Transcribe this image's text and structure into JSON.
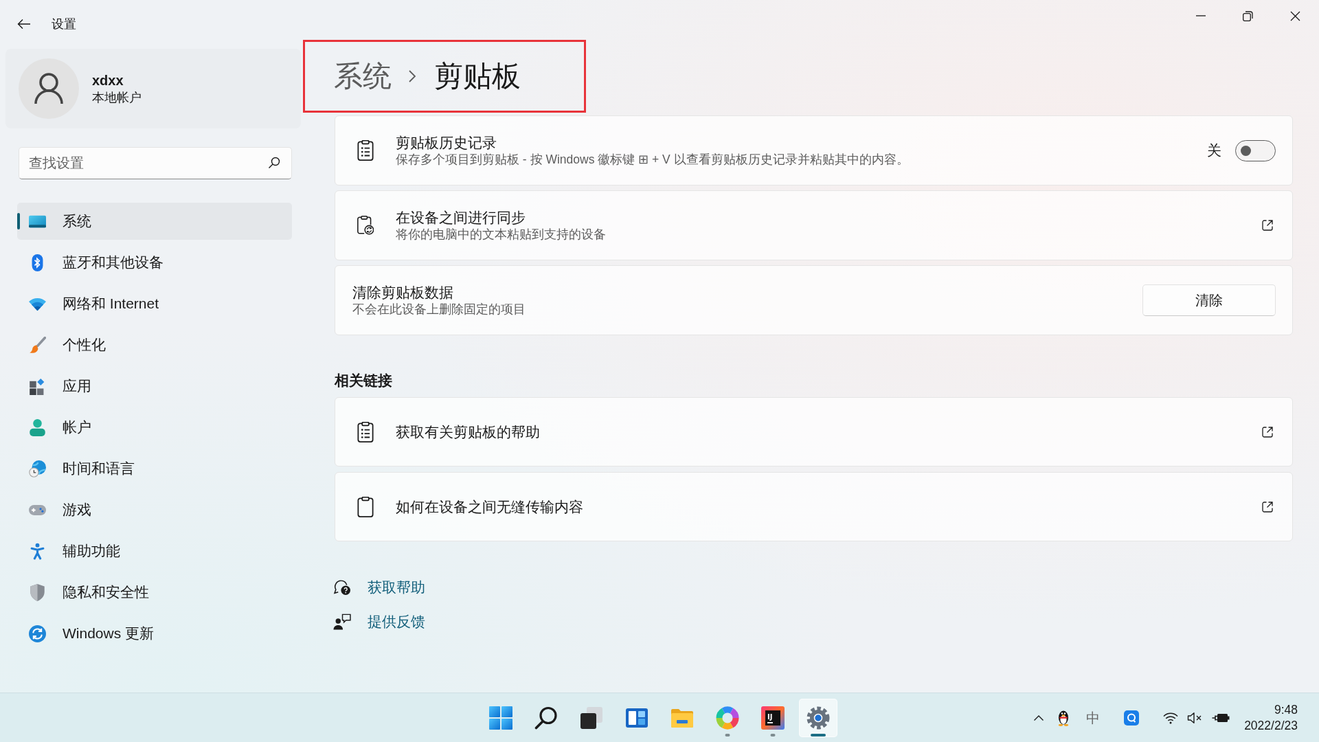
{
  "window": {
    "title": "设置"
  },
  "account": {
    "name": "xdxx",
    "type": "本地帐户"
  },
  "search": {
    "placeholder": "查找设置"
  },
  "sidebar": {
    "items": [
      {
        "label": "系统",
        "selected": true
      },
      {
        "label": "蓝牙和其他设备",
        "selected": false
      },
      {
        "label": "网络和 Internet",
        "selected": false
      },
      {
        "label": "个性化",
        "selected": false
      },
      {
        "label": "应用",
        "selected": false
      },
      {
        "label": "帐户",
        "selected": false
      },
      {
        "label": "时间和语言",
        "selected": false
      },
      {
        "label": "游戏",
        "selected": false
      },
      {
        "label": "辅助功能",
        "selected": false
      },
      {
        "label": "隐私和安全性",
        "selected": false
      },
      {
        "label": "Windows 更新",
        "selected": false
      }
    ]
  },
  "breadcrumb": [
    {
      "label": "系统"
    },
    {
      "label": "剪贴板"
    }
  ],
  "settings": [
    {
      "kind": "toggle",
      "title": "剪贴板历史记录",
      "description": "保存多个项目到剪贴板 - 按 Windows 徽标键 ⊞ + V 以查看剪贴板历史记录并粘贴其中的内容。",
      "state_label": "关",
      "on": false
    },
    {
      "kind": "link",
      "title": "在设备之间进行同步",
      "description": "将你的电脑中的文本粘贴到支持的设备"
    },
    {
      "kind": "button",
      "title": "清除剪贴板数据",
      "description": "不会在此设备上删除固定的项目",
      "button": "清除"
    }
  ],
  "related_links": {
    "heading": "相关链接",
    "items": [
      {
        "label": "获取有关剪贴板的帮助"
      },
      {
        "label": "如何在设备之间无缝传输内容"
      }
    ]
  },
  "help_links": [
    {
      "label": "获取帮助"
    },
    {
      "label": "提供反馈"
    }
  ],
  "taskbar": {
    "buttons": [
      {
        "running": false,
        "selected": false
      },
      {
        "running": false,
        "selected": false
      },
      {
        "running": false,
        "selected": false
      },
      {
        "running": false,
        "selected": false
      },
      {
        "running": false,
        "selected": false
      },
      {
        "running": true,
        "selected": false
      },
      {
        "running": true,
        "selected": false,
        "logo_text": "IJ"
      },
      {
        "running": true,
        "selected": true
      }
    ]
  },
  "tray": {
    "ime": "中",
    "time": "9:48",
    "date": "2022/2/23"
  }
}
